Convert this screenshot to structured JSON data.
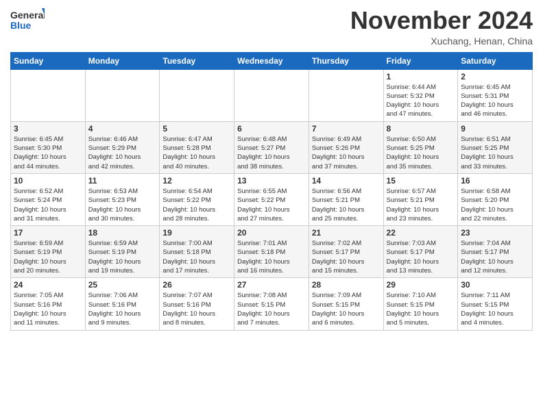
{
  "header": {
    "logo_line1": "General",
    "logo_line2": "Blue",
    "month": "November 2024",
    "location": "Xuchang, Henan, China"
  },
  "weekdays": [
    "Sunday",
    "Monday",
    "Tuesday",
    "Wednesday",
    "Thursday",
    "Friday",
    "Saturday"
  ],
  "weeks": [
    [
      {
        "day": "",
        "info": ""
      },
      {
        "day": "",
        "info": ""
      },
      {
        "day": "",
        "info": ""
      },
      {
        "day": "",
        "info": ""
      },
      {
        "day": "",
        "info": ""
      },
      {
        "day": "1",
        "info": "Sunrise: 6:44 AM\nSunset: 5:32 PM\nDaylight: 10 hours\nand 47 minutes."
      },
      {
        "day": "2",
        "info": "Sunrise: 6:45 AM\nSunset: 5:31 PM\nDaylight: 10 hours\nand 46 minutes."
      }
    ],
    [
      {
        "day": "3",
        "info": "Sunrise: 6:45 AM\nSunset: 5:30 PM\nDaylight: 10 hours\nand 44 minutes."
      },
      {
        "day": "4",
        "info": "Sunrise: 6:46 AM\nSunset: 5:29 PM\nDaylight: 10 hours\nand 42 minutes."
      },
      {
        "day": "5",
        "info": "Sunrise: 6:47 AM\nSunset: 5:28 PM\nDaylight: 10 hours\nand 40 minutes."
      },
      {
        "day": "6",
        "info": "Sunrise: 6:48 AM\nSunset: 5:27 PM\nDaylight: 10 hours\nand 38 minutes."
      },
      {
        "day": "7",
        "info": "Sunrise: 6:49 AM\nSunset: 5:26 PM\nDaylight: 10 hours\nand 37 minutes."
      },
      {
        "day": "8",
        "info": "Sunrise: 6:50 AM\nSunset: 5:25 PM\nDaylight: 10 hours\nand 35 minutes."
      },
      {
        "day": "9",
        "info": "Sunrise: 6:51 AM\nSunset: 5:25 PM\nDaylight: 10 hours\nand 33 minutes."
      }
    ],
    [
      {
        "day": "10",
        "info": "Sunrise: 6:52 AM\nSunset: 5:24 PM\nDaylight: 10 hours\nand 31 minutes."
      },
      {
        "day": "11",
        "info": "Sunrise: 6:53 AM\nSunset: 5:23 PM\nDaylight: 10 hours\nand 30 minutes."
      },
      {
        "day": "12",
        "info": "Sunrise: 6:54 AM\nSunset: 5:22 PM\nDaylight: 10 hours\nand 28 minutes."
      },
      {
        "day": "13",
        "info": "Sunrise: 6:55 AM\nSunset: 5:22 PM\nDaylight: 10 hours\nand 27 minutes."
      },
      {
        "day": "14",
        "info": "Sunrise: 6:56 AM\nSunset: 5:21 PM\nDaylight: 10 hours\nand 25 minutes."
      },
      {
        "day": "15",
        "info": "Sunrise: 6:57 AM\nSunset: 5:21 PM\nDaylight: 10 hours\nand 23 minutes."
      },
      {
        "day": "16",
        "info": "Sunrise: 6:58 AM\nSunset: 5:20 PM\nDaylight: 10 hours\nand 22 minutes."
      }
    ],
    [
      {
        "day": "17",
        "info": "Sunrise: 6:59 AM\nSunset: 5:19 PM\nDaylight: 10 hours\nand 20 minutes."
      },
      {
        "day": "18",
        "info": "Sunrise: 6:59 AM\nSunset: 5:19 PM\nDaylight: 10 hours\nand 19 minutes."
      },
      {
        "day": "19",
        "info": "Sunrise: 7:00 AM\nSunset: 5:18 PM\nDaylight: 10 hours\nand 17 minutes."
      },
      {
        "day": "20",
        "info": "Sunrise: 7:01 AM\nSunset: 5:18 PM\nDaylight: 10 hours\nand 16 minutes."
      },
      {
        "day": "21",
        "info": "Sunrise: 7:02 AM\nSunset: 5:17 PM\nDaylight: 10 hours\nand 15 minutes."
      },
      {
        "day": "22",
        "info": "Sunrise: 7:03 AM\nSunset: 5:17 PM\nDaylight: 10 hours\nand 13 minutes."
      },
      {
        "day": "23",
        "info": "Sunrise: 7:04 AM\nSunset: 5:17 PM\nDaylight: 10 hours\nand 12 minutes."
      }
    ],
    [
      {
        "day": "24",
        "info": "Sunrise: 7:05 AM\nSunset: 5:16 PM\nDaylight: 10 hours\nand 11 minutes."
      },
      {
        "day": "25",
        "info": "Sunrise: 7:06 AM\nSunset: 5:16 PM\nDaylight: 10 hours\nand 9 minutes."
      },
      {
        "day": "26",
        "info": "Sunrise: 7:07 AM\nSunset: 5:16 PM\nDaylight: 10 hours\nand 8 minutes."
      },
      {
        "day": "27",
        "info": "Sunrise: 7:08 AM\nSunset: 5:15 PM\nDaylight: 10 hours\nand 7 minutes."
      },
      {
        "day": "28",
        "info": "Sunrise: 7:09 AM\nSunset: 5:15 PM\nDaylight: 10 hours\nand 6 minutes."
      },
      {
        "day": "29",
        "info": "Sunrise: 7:10 AM\nSunset: 5:15 PM\nDaylight: 10 hours\nand 5 minutes."
      },
      {
        "day": "30",
        "info": "Sunrise: 7:11 AM\nSunset: 5:15 PM\nDaylight: 10 hours\nand 4 minutes."
      }
    ]
  ]
}
